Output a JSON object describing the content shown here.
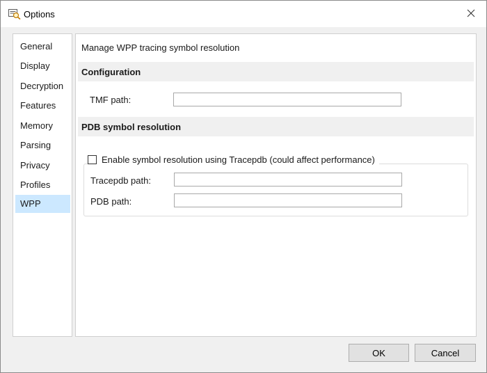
{
  "window": {
    "title": "Options"
  },
  "sidebar": {
    "items": [
      {
        "label": "General"
      },
      {
        "label": "Display"
      },
      {
        "label": "Decryption"
      },
      {
        "label": "Features"
      },
      {
        "label": "Memory"
      },
      {
        "label": "Parsing"
      },
      {
        "label": "Privacy"
      },
      {
        "label": "Profiles"
      },
      {
        "label": "WPP"
      }
    ],
    "selected": "WPP"
  },
  "main": {
    "heading": "Manage WPP tracing symbol resolution",
    "configuration": {
      "title": "Configuration",
      "tmf_label": "TMF path:",
      "tmf_value": ""
    },
    "pdb": {
      "title": "PDB symbol resolution",
      "checkbox_label": "Enable symbol resolution using Tracepdb (could affect performance)",
      "checkbox_checked": false,
      "tracepdb_label": "Tracepdb path:",
      "tracepdb_value": "",
      "pdb_label": "PDB path:",
      "pdb_value": ""
    }
  },
  "buttons": {
    "ok": "OK",
    "cancel": "Cancel"
  },
  "colors": {
    "selection": "#cce8ff",
    "band": "#f0f0f0"
  },
  "icons": {
    "app": "options-icon",
    "close": "close-icon"
  }
}
